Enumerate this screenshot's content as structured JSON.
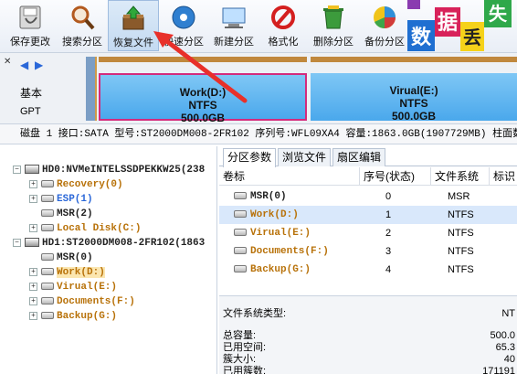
{
  "toolbar": {
    "buttons": [
      {
        "label": "保存更改",
        "icon": "save-icon"
      },
      {
        "label": "搜索分区",
        "icon": "magnifier-icon"
      },
      {
        "label": "恢复文件",
        "icon": "recover-box-icon"
      },
      {
        "label": "快速分区",
        "icon": "disk-icon"
      },
      {
        "label": "新建分区",
        "icon": "new-partition-icon"
      },
      {
        "label": "格式化",
        "icon": "format-icon"
      },
      {
        "label": "删除分区",
        "icon": "trash-icon"
      },
      {
        "label": "备份分区",
        "icon": "pie-backup-icon"
      }
    ],
    "brand_chars": [
      "数",
      "据",
      "丢",
      "失"
    ]
  },
  "diskbar": {
    "basic": "基本",
    "gpt": "GPT",
    "partitions": [
      {
        "name": "Work(D:)",
        "fs": "NTFS",
        "size": "500.0GB"
      },
      {
        "name": "Virual(E:)",
        "fs": "NTFS",
        "size": "500.0GB"
      }
    ]
  },
  "diskinfo": "磁盘 1 接口:SATA  型号:ST2000DM008-2FR102  序列号:WFL09XA4  容量:1863.0GB(1907729MB)  柱面数",
  "tree": {
    "disks": [
      {
        "label": "HD0:NVMeINTELSSDPEKKW25(238",
        "children": [
          {
            "label": "Recovery(0)",
            "color": "orange"
          },
          {
            "label": "ESP(1)",
            "color": "blue"
          },
          {
            "label": "MSR(2)",
            "color": "black"
          },
          {
            "label": "Local Disk(C:)",
            "color": "orange"
          }
        ]
      },
      {
        "label": "HD1:ST2000DM008-2FR102(1863",
        "children": [
          {
            "label": "MSR(0)",
            "color": "black"
          },
          {
            "label": "Work(D:)",
            "color": "orange"
          },
          {
            "label": "Virual(E:)",
            "color": "orange"
          },
          {
            "label": "Documents(F:)",
            "color": "orange"
          },
          {
            "label": "Backup(G:)",
            "color": "orange"
          }
        ]
      }
    ]
  },
  "tabs": [
    "分区参数",
    "浏览文件",
    "扇区编辑"
  ],
  "grid": {
    "headers": [
      "卷标",
      "序号(状态)",
      "文件系统",
      "标识"
    ],
    "rows": [
      {
        "name": "MSR(0)",
        "index": "0",
        "fs": "MSR",
        "color": "black"
      },
      {
        "name": "Work(D:)",
        "index": "1",
        "fs": "NTFS",
        "color": "orange"
      },
      {
        "name": "Virual(E:)",
        "index": "2",
        "fs": "NTFS",
        "color": "orange"
      },
      {
        "name": "Documents(F:)",
        "index": "3",
        "fs": "NTFS",
        "color": "orange"
      },
      {
        "name": "Backup(G:)",
        "index": "4",
        "fs": "NTFS",
        "color": "orange"
      }
    ]
  },
  "fsinfo": {
    "type_label": "文件系统类型:",
    "type_value": "NT",
    "rows": [
      {
        "label": "总容量:",
        "value": "500.0"
      },
      {
        "label": "已用空间:",
        "value": "65.3"
      },
      {
        "label": "簇大小:",
        "value": "40"
      },
      {
        "label": "已用簇数:",
        "value": "171191"
      }
    ]
  },
  "colors": {
    "accent_pink": "#d42b7c",
    "partition_blue": "#4aa8ec",
    "tree_orange": "#b8720a",
    "arrow_red": "#e8302a"
  }
}
